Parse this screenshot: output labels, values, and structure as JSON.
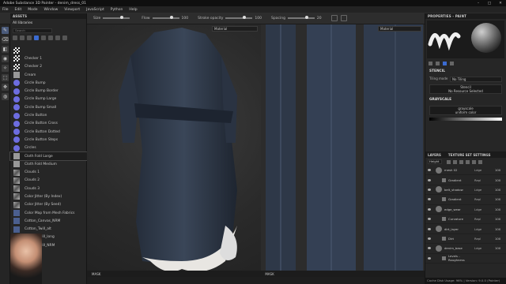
{
  "window": {
    "title": "Adobe Substance 3D Painter - denim_dress_01",
    "controls": [
      "–",
      "□",
      "✕"
    ]
  },
  "menu": [
    "File",
    "Edit",
    "Mode",
    "Window",
    "Viewport",
    "JavaScript",
    "Python",
    "Help"
  ],
  "toolbar": {
    "size_label": "Size",
    "flow_label": "Flow",
    "flow_value": "100",
    "stroke_opacity_label": "Stroke opacity",
    "stroke_opacity_value": "100",
    "spacing_label": "Spacing",
    "spacing_value": "20"
  },
  "tools": [
    "✎",
    "⌫",
    "◧",
    "◉",
    "✧",
    "⬚",
    "✥",
    "◍"
  ],
  "assets": {
    "panel_title": "ASSETS",
    "library": "All libraries",
    "search_placeholder": "Search",
    "items": [
      {
        "label": "",
        "thumb": "chk"
      },
      {
        "label": "Checker 1",
        "thumb": "chk"
      },
      {
        "label": "Checker 2",
        "thumb": "chk"
      },
      {
        "label": "Cream",
        "thumb": "sq"
      },
      {
        "label": "Circle Bump",
        "thumb": "circle"
      },
      {
        "label": "Circle Bump Border",
        "thumb": "circle"
      },
      {
        "label": "Circle Bump Large",
        "thumb": "circle"
      },
      {
        "label": "Circle Bump Small",
        "thumb": "circle"
      },
      {
        "label": "Circle Button",
        "thumb": "circle"
      },
      {
        "label": "Circle Button Cross",
        "thumb": "circle"
      },
      {
        "label": "Circle Button Dotted",
        "thumb": "circle"
      },
      {
        "label": "Circle Button Steps",
        "thumb": "circle"
      },
      {
        "label": "Circles",
        "thumb": "circle"
      },
      {
        "label": "Cloth Fold Large",
        "thumb": "sq",
        "selected": true
      },
      {
        "label": "Cloth Fold Medium",
        "thumb": "sq"
      },
      {
        "label": "Clouds 1",
        "thumb": "cloud"
      },
      {
        "label": "Clouds 2",
        "thumb": "cloud"
      },
      {
        "label": "Clouds 3",
        "thumb": "cloud"
      },
      {
        "label": "Color Jitter (By Index)",
        "thumb": "cloud"
      },
      {
        "label": "Color Jitter (By Seed)",
        "thumb": "cloud"
      },
      {
        "label": "Color Map from Mesh Fabrics",
        "thumb": "fab"
      },
      {
        "label": "Cotton_Canvas_NRM",
        "thumb": "fab"
      },
      {
        "label": "Cotton_Twill_alt",
        "thumb": "fab"
      },
      {
        "label": "Cotton_Twill_long",
        "thumb": "fab"
      },
      {
        "label": "Cotton_Twill_NRM",
        "thumb": "fab"
      }
    ]
  },
  "viewport3d": {
    "mode": "Material",
    "status_label": "MASK"
  },
  "viewport2d": {
    "mode": "Material",
    "status_label": "MASK"
  },
  "properties": {
    "panel_title": "PROPERTIES - PAINT",
    "stencil_title": "STENCIL",
    "tiling_label": "Tiling mode",
    "tiling_value": "No Tiling",
    "stencil_box_title": "Stencil",
    "stencil_box_sub": "No Resource Selected",
    "grayscale_title": "GRAYSCALE",
    "grayscale_box_title": "grayscale",
    "grayscale_box_sub": "uniform color"
  },
  "layers": {
    "tabs": [
      "LAYERS",
      "TEXTURE SET SETTINGS"
    ],
    "channel": "Height",
    "items": [
      {
        "name": "mesh 02",
        "blend": "Ldge",
        "opacity": "100",
        "sub": false
      },
      {
        "name": "Gradient",
        "blend": "Repl",
        "opacity": "100",
        "sub": true
      },
      {
        "name": "belt_shadow",
        "blend": "Ldge",
        "opacity": "100",
        "sub": false
      },
      {
        "name": "Gradient",
        "blend": "Repl",
        "opacity": "100",
        "sub": true
      },
      {
        "name": "edge_wear",
        "blend": "Ldge",
        "opacity": "100",
        "sub": false
      },
      {
        "name": "Curvature",
        "blend": "Repl",
        "opacity": "100",
        "sub": true
      },
      {
        "name": "dirt_layer",
        "blend": "Ldge",
        "opacity": "100",
        "sub": false
      },
      {
        "name": "Dirt",
        "blend": "Repl",
        "opacity": "100",
        "sub": true
      },
      {
        "name": "denim_base",
        "blend": "Ldge",
        "opacity": "100",
        "sub": false
      },
      {
        "name": "Levels - Roughness",
        "blend": "",
        "opacity": "",
        "sub": true
      }
    ]
  },
  "footer": "Cache Disk Usage: 96% | Version: 9.0.0 (Painter)",
  "colors": {
    "accent": "#3b6bd1",
    "denim": "#2f3a4c",
    "ruffle": "#e8e6e2"
  }
}
